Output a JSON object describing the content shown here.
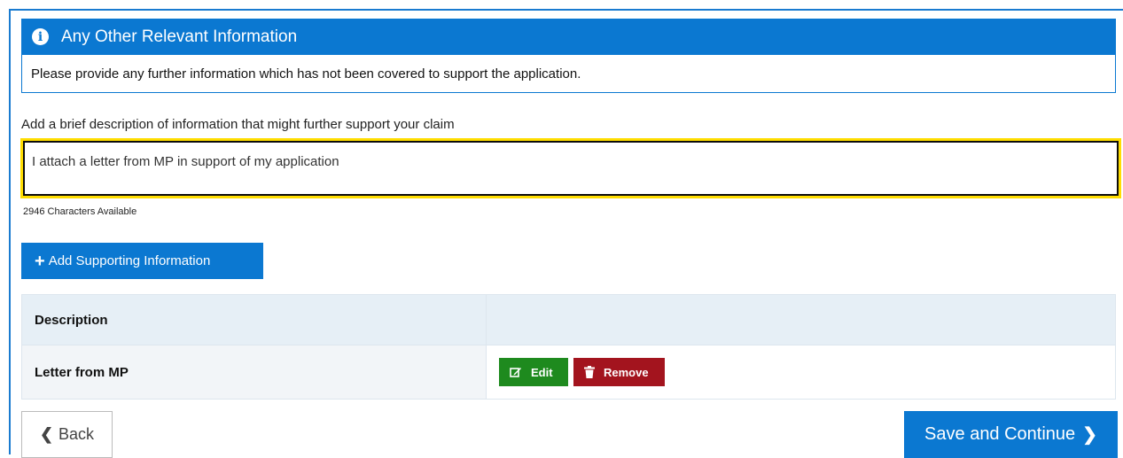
{
  "panel": {
    "title": "Any Other Relevant Information",
    "info_icon": "info-circle-icon",
    "body": "Please provide any further information which has not been covered to support the application."
  },
  "field": {
    "label": "Add a brief description of information that might further support your claim",
    "value": "I attach a letter from MP in support of my application",
    "characters_available": "2946 Characters Available"
  },
  "add_button": {
    "icon": "plus-icon",
    "label": "Add Supporting Information"
  },
  "table": {
    "header": {
      "description": "Description",
      "actions": ""
    },
    "rows": [
      {
        "description": "Letter from MP",
        "edit_label": "Edit",
        "remove_label": "Remove"
      }
    ]
  },
  "nav": {
    "back_label": "Back",
    "save_label": "Save and Continue"
  },
  "colors": {
    "primary": "#0b78d1",
    "focus": "#ffdd00",
    "edit": "#1e8a1e",
    "remove": "#a3141e"
  }
}
